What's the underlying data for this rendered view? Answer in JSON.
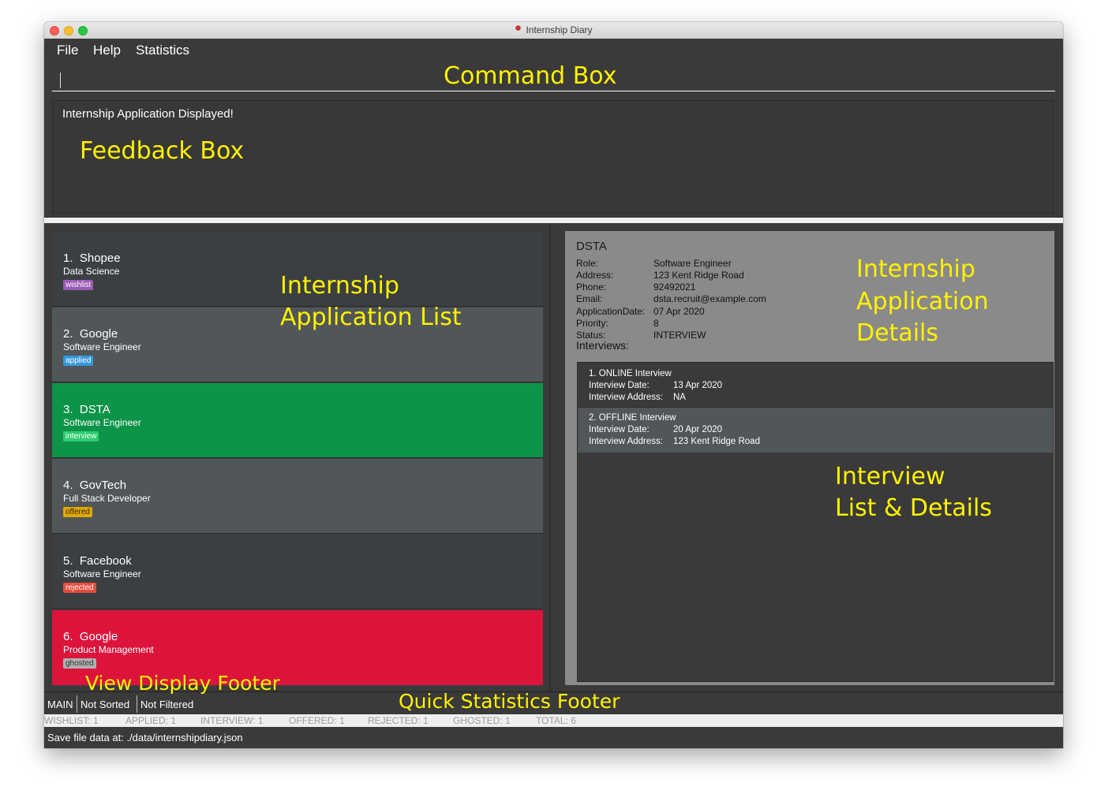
{
  "window": {
    "title": "Internship Diary"
  },
  "menu": [
    "File",
    "Help",
    "Statistics"
  ],
  "feedback": "Internship Application Displayed!",
  "applications": [
    {
      "index": "1.",
      "company": "Shopee",
      "role": "Data Science",
      "status": "wishlist"
    },
    {
      "index": "2.",
      "company": "Google",
      "role": "Software Engineer",
      "status": "applied"
    },
    {
      "index": "3.",
      "company": "DSTA",
      "role": "Software Engineer",
      "status": "interview"
    },
    {
      "index": "4.",
      "company": "GovTech",
      "role": "Full Stack Developer",
      "status": "offered"
    },
    {
      "index": "5.",
      "company": "Facebook",
      "role": "Software Engineer",
      "status": "rejected"
    },
    {
      "index": "6.",
      "company": "Google",
      "role": "Product Management",
      "status": "ghosted"
    }
  ],
  "details": {
    "company": "DSTA",
    "fields": [
      {
        "key": "Role:",
        "value": "Software Engineer"
      },
      {
        "key": "Address:",
        "value": "123 Kent Ridge Road"
      },
      {
        "key": "Phone:",
        "value": "92492021"
      },
      {
        "key": "Email:",
        "value": "dsta.recruit@example.com"
      },
      {
        "key": "ApplicationDate:",
        "value": "07 Apr 2020"
      },
      {
        "key": "Priority:",
        "value": "8"
      },
      {
        "key": "Status:",
        "value": "INTERVIEW"
      }
    ],
    "interviews_label": "Interviews:",
    "interviews": [
      {
        "title": "1. ONLINE Interview",
        "date_label": "Interview Date:",
        "date": "13 Apr 2020",
        "address_label": "Interview Address:",
        "address": "NA"
      },
      {
        "title": "2. OFFLINE Interview",
        "date_label": "Interview Date:",
        "date": "20 Apr 2020",
        "address_label": "Interview Address:",
        "address": "123 Kent Ridge Road"
      }
    ]
  },
  "view_footer": {
    "view": "MAIN",
    "sort": "Not Sorted",
    "filter": "Not Filtered"
  },
  "stats": [
    "WISHLIST: 1",
    "APPLIED: 1",
    "INTERVIEW: 1",
    "OFFERED: 1",
    "REJECTED: 1",
    "GHOSTED: 1",
    "TOTAL: 6"
  ],
  "save_path": "Save file data at: ./data/internshipdiary.json",
  "annotations": {
    "command_box": "Command Box",
    "feedback_box": "Feedback Box",
    "app_list_1": "Internship",
    "app_list_2": "Application List",
    "app_details_1": "Internship",
    "app_details_2": "Application",
    "app_details_3": "Details",
    "interview_1": "Interview",
    "interview_2": "List & Details",
    "view_footer": "View Display Footer",
    "stats_footer": "Quick Statistics Footer"
  },
  "colors": {
    "wishlist": "#9b59b6",
    "applied": "#3498db",
    "interview": "#27ae60",
    "offered": "#e0a800",
    "rejected": "#e74c3c",
    "ghosted": "#9e9e9e",
    "selected_item": "#0d9448",
    "ghosted_item": "#dc143c",
    "annotation": "#fff200"
  }
}
